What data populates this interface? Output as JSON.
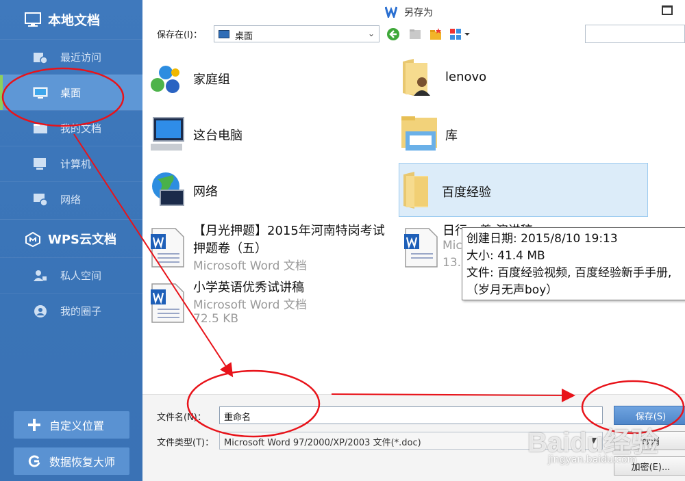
{
  "sidebar": {
    "local_header": "本地文档",
    "items": [
      {
        "label": "最近访问",
        "icon": "recent-icon"
      },
      {
        "label": "桌面",
        "icon": "desktop-icon",
        "active": true
      },
      {
        "label": "我的文档",
        "icon": "documents-icon"
      },
      {
        "label": "计算机",
        "icon": "computer-icon"
      },
      {
        "label": "网络",
        "icon": "network-icon"
      }
    ],
    "cloud_header": "WPS云文档",
    "cloud_items": [
      {
        "label": "私人空间",
        "icon": "private-space-icon"
      },
      {
        "label": "我的圈子",
        "icon": "circle-icon"
      }
    ],
    "custom_location": "自定义位置",
    "data_recovery": "数据恢复大师"
  },
  "window": {
    "title": "另存为"
  },
  "toolbar": {
    "save_in_label": "保存在(I)：",
    "save_in_value": "桌面",
    "icons": [
      "back-icon",
      "up-folder-icon",
      "new-folder-icon",
      "view-menu-icon"
    ]
  },
  "files": [
    {
      "name": "家庭组",
      "icon": "homegroup-icon"
    },
    {
      "name": "lenovo",
      "icon": "user-folder-icon"
    },
    {
      "name": "这台电脑",
      "icon": "this-pc-icon"
    },
    {
      "name": "库",
      "icon": "library-icon"
    },
    {
      "name": "网络",
      "icon": "network-globe-icon"
    },
    {
      "name": "百度经验",
      "icon": "folder-icon",
      "selected": true
    },
    {
      "name_line1": "【月光押题】2015年河南特岗考试",
      "name_line2": "押题卷（五）",
      "type": "Microsoft Word 文档",
      "icon": "word-doc-icon"
    },
    {
      "name_line1": "日行一善 演讲稿",
      "type": "Mic",
      "size": "13.",
      "icon": "word-doc-icon"
    },
    {
      "name": "小学英语优秀试讲稿",
      "type": "Microsoft Word 文档",
      "size": "72.5 KB",
      "icon": "word-doc-icon"
    }
  ],
  "tooltip": {
    "created": "创建日期: 2015/8/10 19:13",
    "size": "大小: 41.4 MB",
    "files": "文件: 百度经验视频, 百度经验新手手册,",
    "files_more": "（岁月无声boy）"
  },
  "bottom": {
    "filename_label": "文件名(N)：",
    "filename_value": "重命名",
    "filetype_label": "文件类型(T)：",
    "filetype_value": "Microsoft Word 97/2000/XP/2003 文件(*.doc)",
    "save_button": "保存(S)",
    "cancel_button": "取消",
    "encrypt_button": "加密(E)..."
  },
  "watermark": {
    "brand": "Baidu经验",
    "url": "jingyan.baidu.com"
  },
  "colors": {
    "sidebar": "#3a74b7",
    "active": "#5e97d6",
    "annotation": "#e8131a",
    "selected": "#dcecf9"
  }
}
